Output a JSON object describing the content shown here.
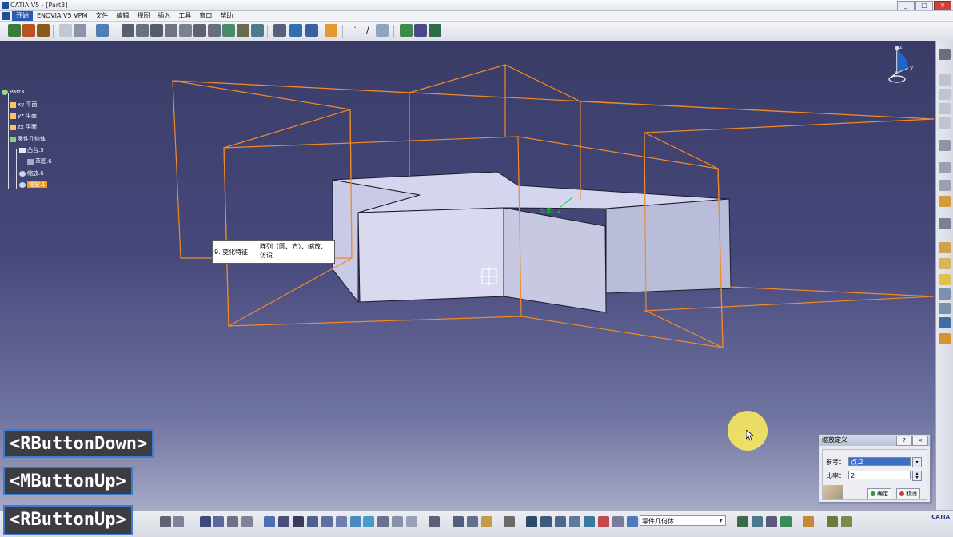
{
  "window": {
    "title": "CATIA V5 - [Part3]",
    "buttons": {
      "minimize": "_",
      "maximize": "□",
      "close": "×"
    },
    "inner_buttons": {
      "minimize": "_",
      "maximize": "▫",
      "close": "×"
    }
  },
  "menu": {
    "items": [
      "开始",
      "ENOVIA V5 VPM",
      "文件",
      "编辑",
      "视图",
      "插入",
      "工具",
      "窗口",
      "帮助"
    ]
  },
  "tree": {
    "root": "Part3",
    "items": [
      {
        "label": "xy 平面",
        "icon": "plane-icon"
      },
      {
        "label": "yz 平面",
        "icon": "plane-icon"
      },
      {
        "label": "zx 平面",
        "icon": "plane-icon"
      },
      {
        "label": "零件几何体",
        "icon": "body-icon"
      },
      {
        "label": "凸台.5",
        "icon": "pad-icon"
      },
      {
        "label": "草图.6",
        "icon": "sketch-icon"
      },
      {
        "label": "缩放.6",
        "icon": "scaling-icon"
      },
      {
        "label": "缩放.1",
        "icon": "scaling-icon",
        "highlighted": true
      }
    ]
  },
  "viewport": {
    "annotation": "比率：2",
    "compass": {
      "x": "x",
      "y": "y",
      "z": "z"
    },
    "tooltip": {
      "key": "9. 变化特征",
      "value": "阵列（圆、方）、缩放、仿设"
    },
    "edge_color": "#f08a2a",
    "solid_color": "#d6d7ef"
  },
  "overlay_labels": [
    "<RButtonDown>",
    "<MButtonUp>",
    "<RButtonUp>"
  ],
  "dialog": {
    "title": "缩放定义",
    "help_button": "?",
    "close_button": "×",
    "reference_label": "参考：",
    "reference_value": "点.2",
    "ratio_label": "比率：",
    "ratio_value": "2",
    "ok_label": "确定",
    "cancel_label": "取消"
  },
  "bottom": {
    "body_combo_value": "零件几何体",
    "logo": "CATIA"
  },
  "colors": {
    "accent": "#2a5bb0",
    "tree_highlight": "#f29a1a",
    "label_border": "#3b7cd2",
    "cursor_highlight": "#fff05a"
  }
}
